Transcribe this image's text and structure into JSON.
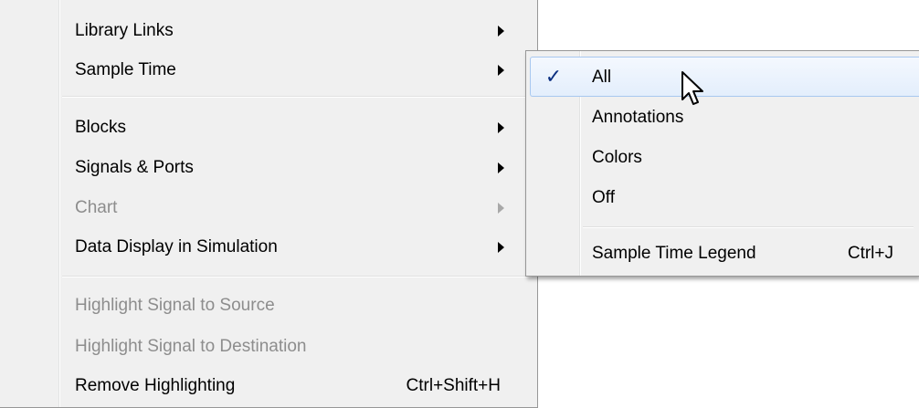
{
  "main_menu": {
    "items": [
      {
        "label": "Library Links",
        "enabled": true,
        "has_submenu": true
      },
      {
        "label": "Sample Time",
        "enabled": true,
        "has_submenu": true
      },
      {
        "label": "Blocks",
        "enabled": true,
        "has_submenu": true
      },
      {
        "label": "Signals & Ports",
        "enabled": true,
        "has_submenu": true
      },
      {
        "label": "Chart",
        "enabled": false,
        "has_submenu": true
      },
      {
        "label": "Data Display in Simulation",
        "enabled": true,
        "has_submenu": true
      },
      {
        "label": "Highlight Signal to Source",
        "enabled": false,
        "has_submenu": false
      },
      {
        "label": "Highlight Signal to Destination",
        "enabled": false,
        "has_submenu": false
      },
      {
        "label": "Remove Highlighting",
        "enabled": true,
        "has_submenu": false,
        "shortcut": "Ctrl+Shift+H"
      }
    ]
  },
  "submenu": {
    "parent": "Sample Time",
    "items": [
      {
        "label": "All",
        "checked": true,
        "highlighted": true
      },
      {
        "label": "Annotations",
        "checked": false
      },
      {
        "label": "Colors",
        "checked": false
      },
      {
        "label": "Off",
        "checked": false
      },
      {
        "label": "Sample Time Legend",
        "shortcut": "Ctrl+J",
        "checked": false
      }
    ],
    "check_glyph": "✓"
  },
  "icons": {
    "submenu_arrow": "chevron-right-icon",
    "check": "checkmark-icon",
    "cursor": "mouse-pointer-icon"
  },
  "colors": {
    "menu_bg": "#f0f0f0",
    "disabled_text": "#8d8d8d",
    "highlight_border": "#a8c8f0",
    "check": "#0b2f80"
  }
}
